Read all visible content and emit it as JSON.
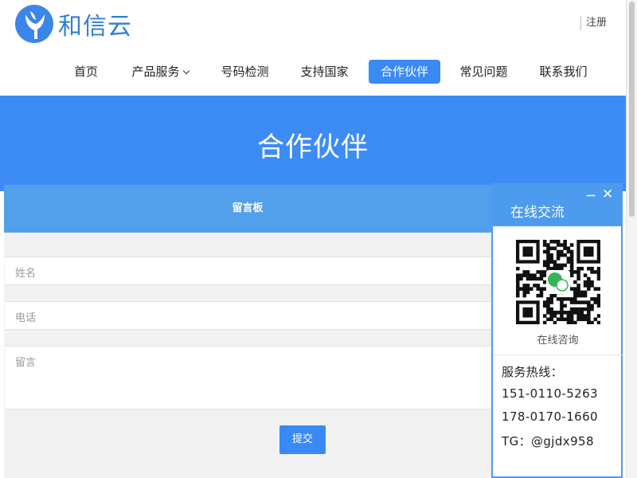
{
  "site": {
    "logo_text": "和信云",
    "register_label": "注册"
  },
  "nav": {
    "items": [
      {
        "label": "首页"
      },
      {
        "label": "产品服务"
      },
      {
        "label": "号码检测"
      },
      {
        "label": "支持国家"
      },
      {
        "label": "合作伙伴"
      },
      {
        "label": "常见问题"
      },
      {
        "label": "联系我们"
      }
    ],
    "active_index": 4
  },
  "banner": {
    "title": "合作伙伴"
  },
  "guestbook": {
    "title": "留言板",
    "name_placeholder": "姓名",
    "phone_placeholder": "电话",
    "message_placeholder": "留言",
    "submit_label": "提交"
  },
  "chat": {
    "title": "在线交流",
    "minimize_label": "－",
    "close_label": "✕",
    "qr_caption": "在线咨询",
    "hotline_label": "服务热线：",
    "phones": [
      "151-0110-5263",
      "178-0170-1660"
    ],
    "tg": "TG：@gjdx958"
  },
  "colors": {
    "brand": "#3a8af5",
    "banner": "#3d8cf6",
    "panel_header": "#52a0ec",
    "chat_header": "#4c9bee"
  }
}
